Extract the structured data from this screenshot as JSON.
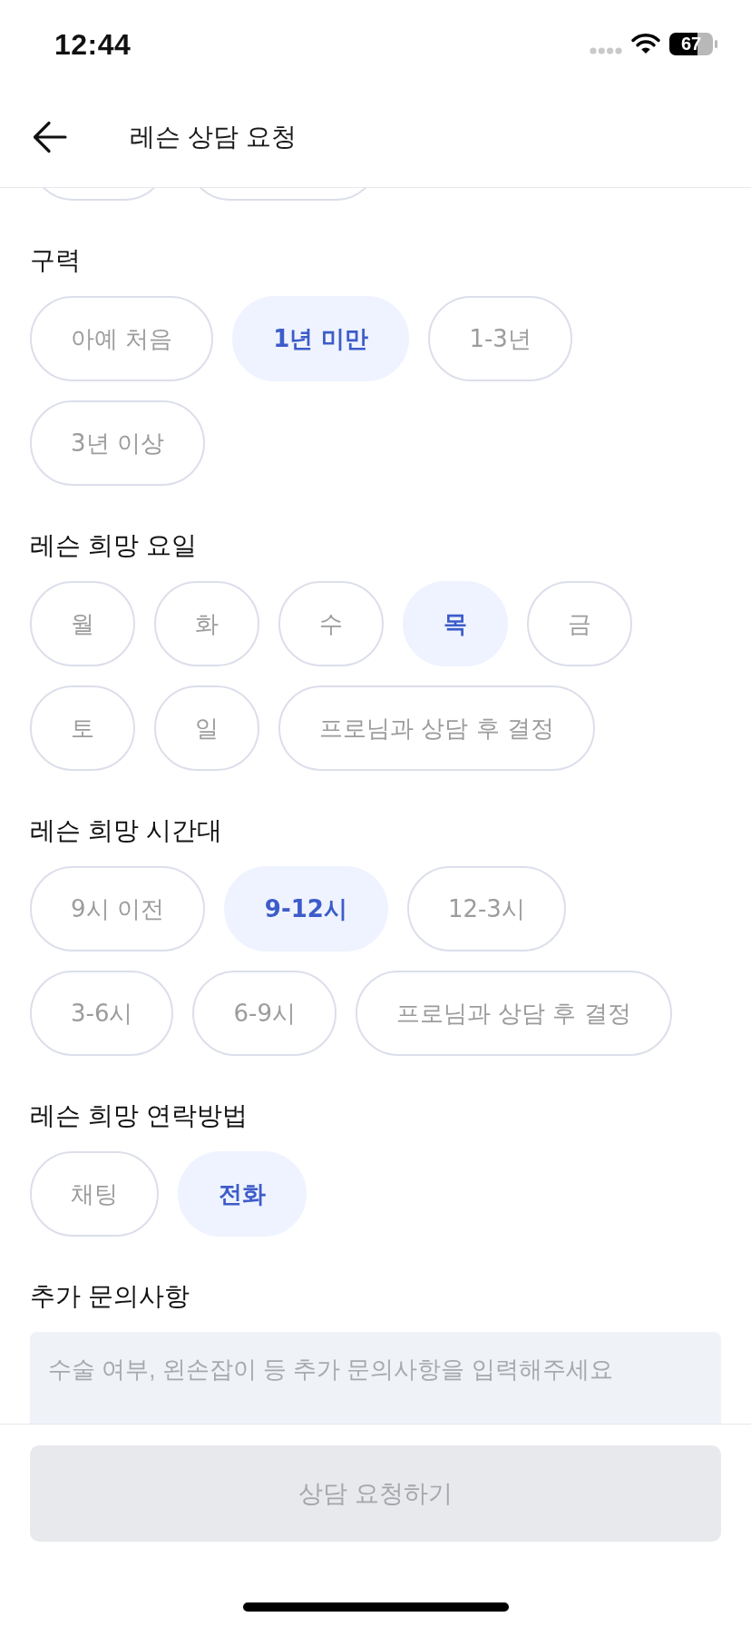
{
  "status_bar": {
    "time": "12:44",
    "battery": "67"
  },
  "header": {
    "title": "레슨 상담 요청"
  },
  "cut_off_options": [
    {
      "selected": false
    },
    {
      "selected": false
    }
  ],
  "sections": [
    {
      "label": "구력",
      "options": [
        {
          "label": "아예 처음",
          "selected": false
        },
        {
          "label": "1년 미만",
          "selected": true
        },
        {
          "label": "1-3년",
          "selected": false
        },
        {
          "label": "3년 이상",
          "selected": false
        }
      ]
    },
    {
      "label": "레슨 희망 요일",
      "options": [
        {
          "label": "월",
          "selected": false
        },
        {
          "label": "화",
          "selected": false
        },
        {
          "label": "수",
          "selected": false
        },
        {
          "label": "목",
          "selected": true
        },
        {
          "label": "금",
          "selected": false
        },
        {
          "label": "토",
          "selected": false
        },
        {
          "label": "일",
          "selected": false
        },
        {
          "label": "프로님과 상담 후 결정",
          "selected": false
        }
      ]
    },
    {
      "label": "레슨 희망 시간대",
      "options": [
        {
          "label": "9시 이전",
          "selected": false
        },
        {
          "label": "9-12시",
          "selected": true
        },
        {
          "label": "12-3시",
          "selected": false
        },
        {
          "label": "3-6시",
          "selected": false
        },
        {
          "label": "6-9시",
          "selected": false
        },
        {
          "label": "프로님과 상담 후 결정",
          "selected": false
        }
      ]
    },
    {
      "label": "레슨 희망 연락방법",
      "options": [
        {
          "label": "채팅",
          "selected": false
        },
        {
          "label": "전화",
          "selected": true
        }
      ]
    }
  ],
  "inquiry": {
    "label": "추가 문의사항",
    "placeholder": "수술 여부, 왼손잡이 등 추가 문의사항을 입력해주세요"
  },
  "submit_button": {
    "label": "상담 요청하기",
    "disabled": true
  }
}
